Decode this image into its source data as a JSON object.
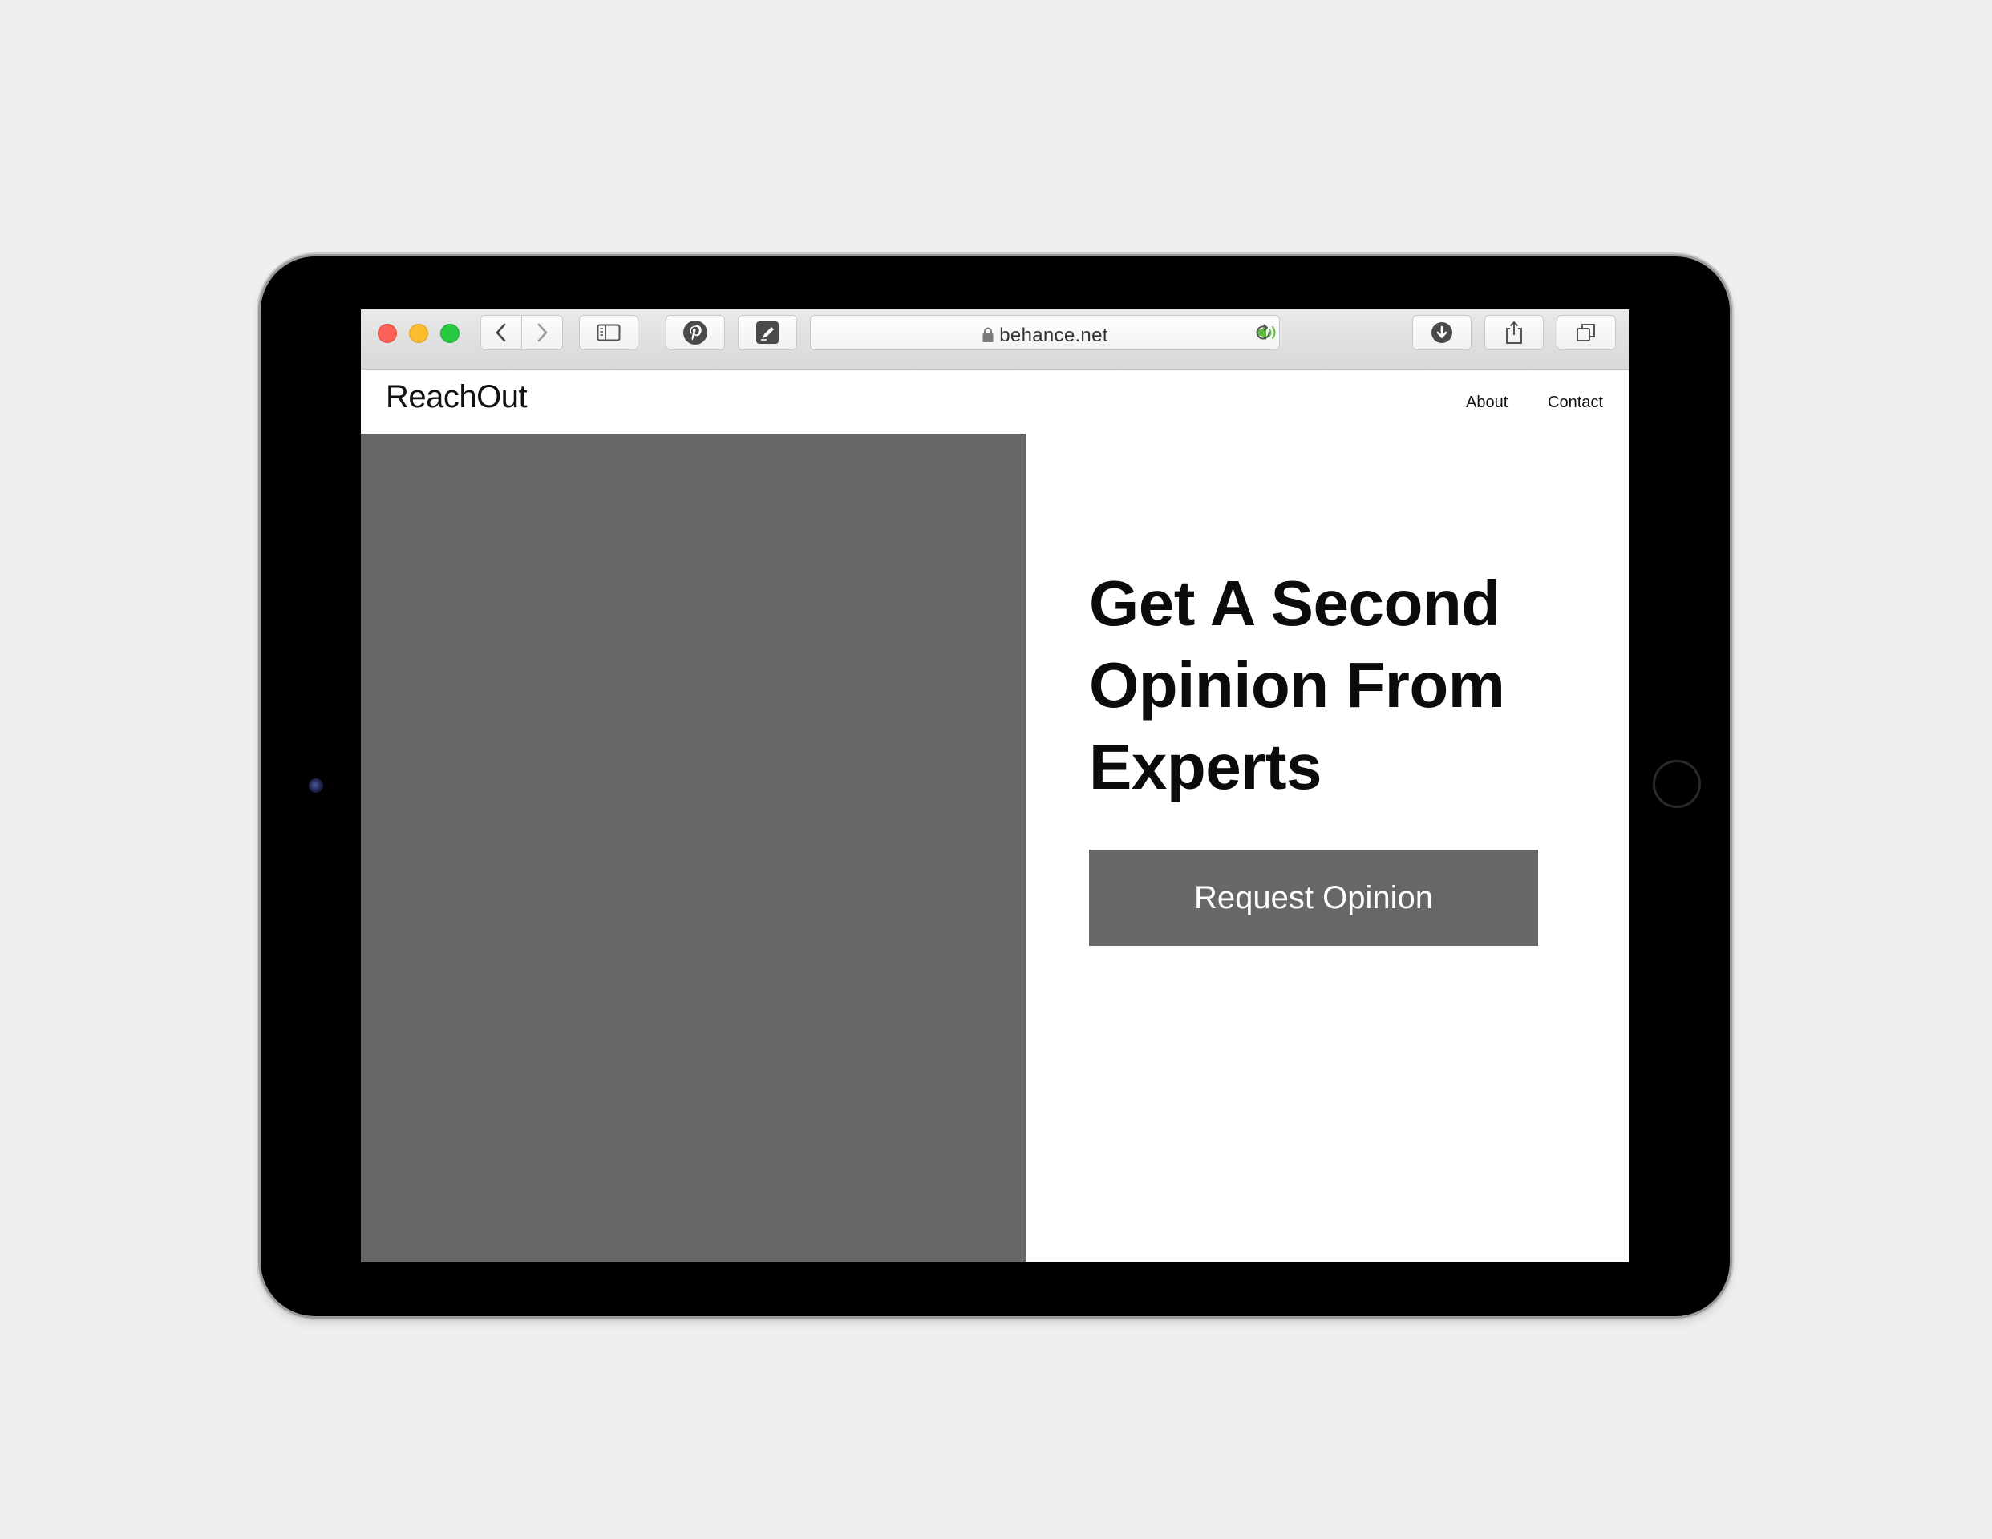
{
  "browser": {
    "url": "behance.net",
    "icons": {
      "back": "chevron-left-icon",
      "forward": "chevron-right-icon",
      "sidebar": "sidebar-icon",
      "pinterest": "pinterest-icon",
      "annotate": "markup-icon",
      "lock": "lock-icon",
      "audio": "speaker-icon",
      "reload": "reload-icon",
      "downloads": "download-icon",
      "share": "share-icon",
      "tabs": "tabs-icon"
    },
    "colors": {
      "close": "#fc5f57",
      "minimize": "#fdbc2e",
      "zoom": "#28c840",
      "audio": "#5cbf3c"
    }
  },
  "site": {
    "logo": "ReachOut",
    "nav": {
      "about": "About",
      "contact": "Contact"
    },
    "hero": {
      "title": "Get A Second Opinion From Experts",
      "cta": "Request Opinion"
    },
    "colors": {
      "placeholder": "#676767",
      "button": "#676767",
      "text": "#0b0b0b"
    }
  }
}
